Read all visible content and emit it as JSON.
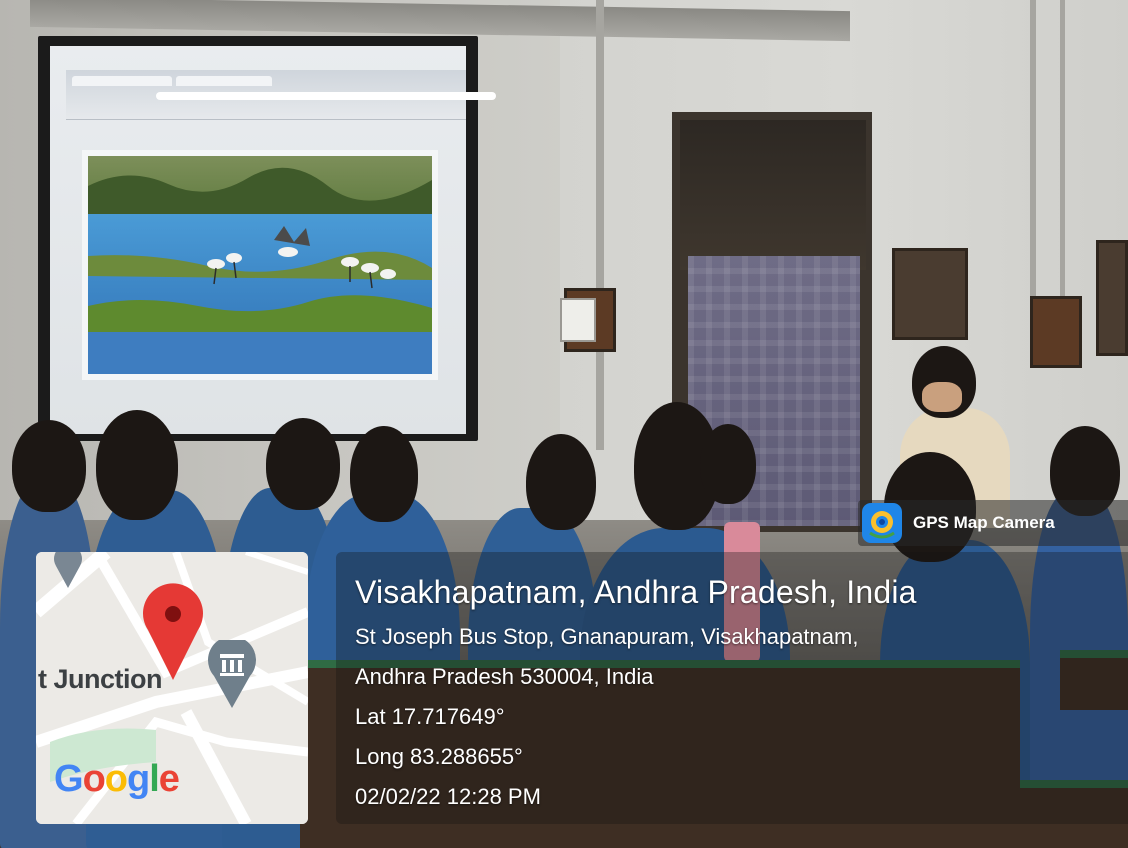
{
  "overlay": {
    "app_name": "GPS Map Camera",
    "location_title": "Visakhapatnam, Andhra Pradesh, India",
    "address_line_1": "St Joseph Bus Stop, Gnanapuram, Visakhapatnam,",
    "address_line_2": "Andhra Pradesh 530004, India",
    "latitude": "Lat 17.717649°",
    "longitude": "Long 83.288655°",
    "datetime": "02/02/22 12:28 PM"
  },
  "map": {
    "place_label": "t Junction",
    "brand": "Google",
    "pin_color": "#e53935",
    "marker_icon": "museum-icon",
    "google_colors": [
      "#4285F4",
      "#EA4335",
      "#FBBC05",
      "#4285F4",
      "#34A853",
      "#EA4335"
    ]
  },
  "scene": {
    "screen_content_icon": "birds-photo"
  }
}
